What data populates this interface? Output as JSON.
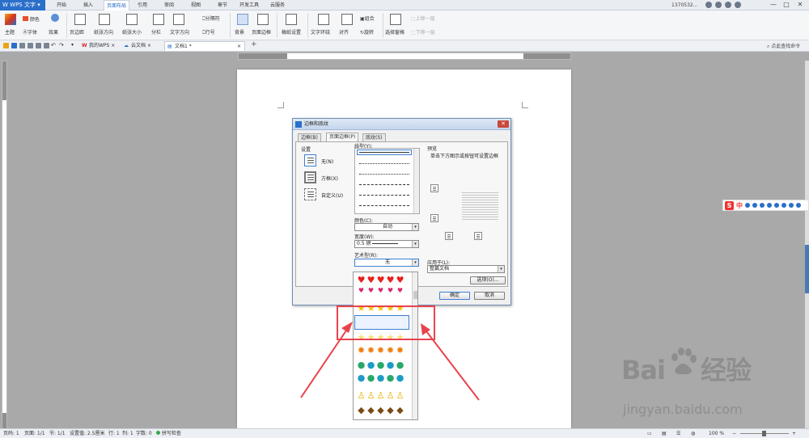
{
  "app": {
    "name": "WPS 文字",
    "menus": [
      "开始",
      "插入",
      "页面布局",
      "引用",
      "审阅",
      "视图",
      "章节",
      "开发工具",
      "云服务"
    ],
    "active_menu": "页面布局",
    "user": "1370532...",
    "win_controls": [
      "—",
      "□",
      "✕"
    ]
  },
  "ribbon": {
    "theme": "主题",
    "color": "颜色",
    "font": "字体",
    "effect": "效果",
    "margin": "页边距",
    "orientation": "纸张方向",
    "size": "纸张大小",
    "columns": "分栏",
    "text_dir": "文字方向",
    "break": "分隔符",
    "line_num": "行号",
    "background": "背景",
    "page_border": "页面边框",
    "draft_setting": "稿纸设置",
    "text_wrap": "文字环绕",
    "align": "对齐",
    "group": "组合",
    "rotate": "旋转",
    "select_pane": "选择窗格",
    "bring_forward": "上移一层",
    "send_backward": "下移一层"
  },
  "tabs": {
    "my_wps": "我的WPS",
    "cloud_doc": "云文档",
    "doc1": "文档1 *",
    "search": "点此查找命令"
  },
  "dialog": {
    "title": "边框和底纹",
    "tabs": [
      "边框(B)",
      "页面边框(P)",
      "底纹(S)"
    ],
    "setting_label": "设置",
    "setting_none": "无(N)",
    "setting_box": "方框(X)",
    "setting_custom": "自定义(U)",
    "line_style_label": "线型(Y):",
    "color_label": "颜色(C):",
    "color_value": "自动",
    "width_label": "宽度(W):",
    "width_value": "0.5  磅",
    "art_label": "艺术型(R):",
    "art_value": "无",
    "preview_label": "预览",
    "preview_hint": "单击下方图示或按钮可设置边框",
    "apply_label": "应用于(L):",
    "apply_value": "整篇文档",
    "options_btn": "选项(O)...",
    "ok_btn": "确定",
    "cancel_btn": "取消"
  },
  "art_options": [
    {
      "name": "hearts",
      "glyph": "♥",
      "color": "#e8201c"
    },
    {
      "name": "hearts-pink",
      "glyph": "♥",
      "color": "#d8286f"
    },
    {
      "name": "blank",
      "glyph": "",
      "color": "#ffffff"
    },
    {
      "name": "stars-gold",
      "glyph": "★",
      "color": "#f4c400"
    },
    {
      "name": "stars-gold-selected",
      "glyph": "★",
      "color": "#f4d000"
    },
    {
      "name": "blank2",
      "glyph": "",
      "color": "#ffffff"
    },
    {
      "name": "suns",
      "glyph": "✹",
      "color": "#f07f10"
    },
    {
      "name": "globes",
      "glyph": "●",
      "color": "#2aa86a"
    },
    {
      "name": "globes2",
      "glyph": "●",
      "color": "#1f9bc7"
    },
    {
      "name": "figures",
      "glyph": "♙",
      "color": "#e8b400"
    },
    {
      "name": "shoes",
      "glyph": "◆",
      "color": "#7a4a14"
    }
  ],
  "status": {
    "page_num": "页码: 1",
    "pages": "页面: 1/1",
    "section": "节: 1/1",
    "setting": "设置值: 2.5厘米",
    "row": "行: 1",
    "col": "列: 1",
    "words": "字数: 0",
    "spell": "拼写检查",
    "zoom": "100 %"
  },
  "watermark": {
    "brand": "Bai",
    "brand_cn": "经验",
    "url": "jingyan.baidu.com"
  },
  "ime": {
    "s": "S",
    "zh": "中"
  }
}
